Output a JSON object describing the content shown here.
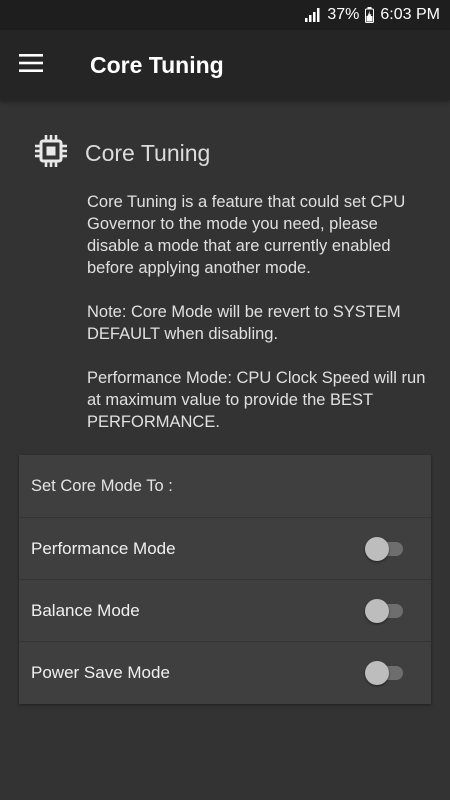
{
  "status_bar": {
    "battery": "37%",
    "time": "6:03 PM"
  },
  "app_bar": {
    "title": "Core Tuning",
    "menu_icon": "hamburger-menu-icon"
  },
  "intro": {
    "icon": "cpu-chip-icon",
    "title": "Core Tuning",
    "paragraphs": [
      "Core Tuning is a feature that could set CPU Governor to the mode you need, please disable a mode that are currently enabled before applying another mode.",
      "Note: Core Mode will be revert to SYSTEM DEFAULT when disabling.",
      "Performance Mode: CPU Clock Speed will run at maximum value to provide the BEST PERFORMANCE."
    ]
  },
  "mode_card": {
    "header": "Set Core Mode To :",
    "modes": [
      {
        "label": "Performance Mode",
        "enabled": false
      },
      {
        "label": "Balance Mode",
        "enabled": false
      },
      {
        "label": "Power Save Mode",
        "enabled": false
      }
    ]
  },
  "colors": {
    "background": "#333333",
    "app_bar": "#252525",
    "card": "#3f3f3f",
    "switch_thumb_off": "#bdbdbd",
    "switch_track_off": "#6e6e6e"
  }
}
